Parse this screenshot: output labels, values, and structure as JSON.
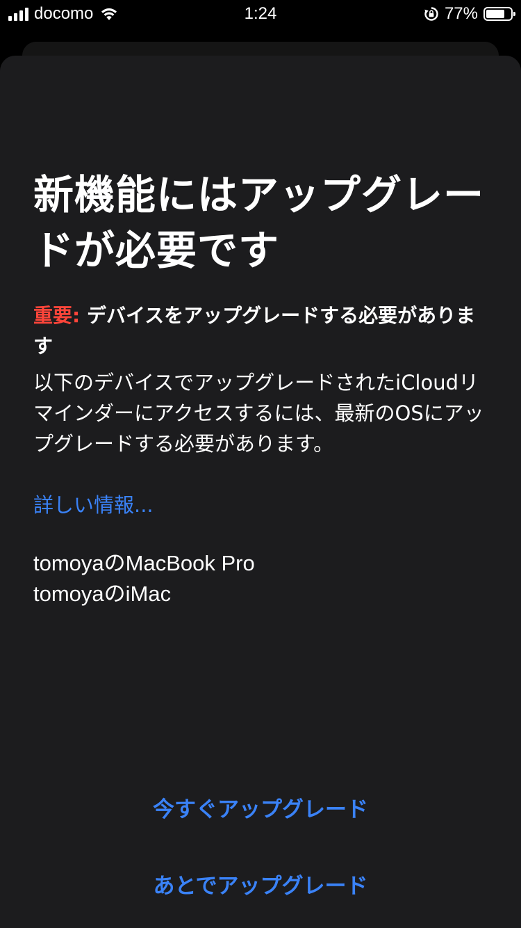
{
  "status_bar": {
    "carrier": "docomo",
    "time": "1:24",
    "battery_percent": "77%",
    "battery_level": 0.77,
    "icons": [
      "signal-icon",
      "wifi-icon",
      "orientation-lock-icon",
      "battery-icon"
    ]
  },
  "sheet": {
    "title": "新機能にはアップグレードが必要です",
    "important_label": "重要:",
    "important_text": " デバイスをアップグレードする必要があります",
    "description": "以下のデバイスでアップグレードされたiCloudリマインダーにアクセスするには、最新のOSにアップグレードする必要があります。",
    "learn_more": "詳しい情報...",
    "devices": [
      "tomoyaのMacBook Pro",
      "tomoyaのiMac"
    ],
    "upgrade_now": "今すぐアップグレード",
    "upgrade_later": "あとでアップグレード"
  },
  "colors": {
    "background": "#000000",
    "sheet": "#1c1c1e",
    "accent": "#3a82f7",
    "important": "#ff453a",
    "text": "#ffffff"
  }
}
